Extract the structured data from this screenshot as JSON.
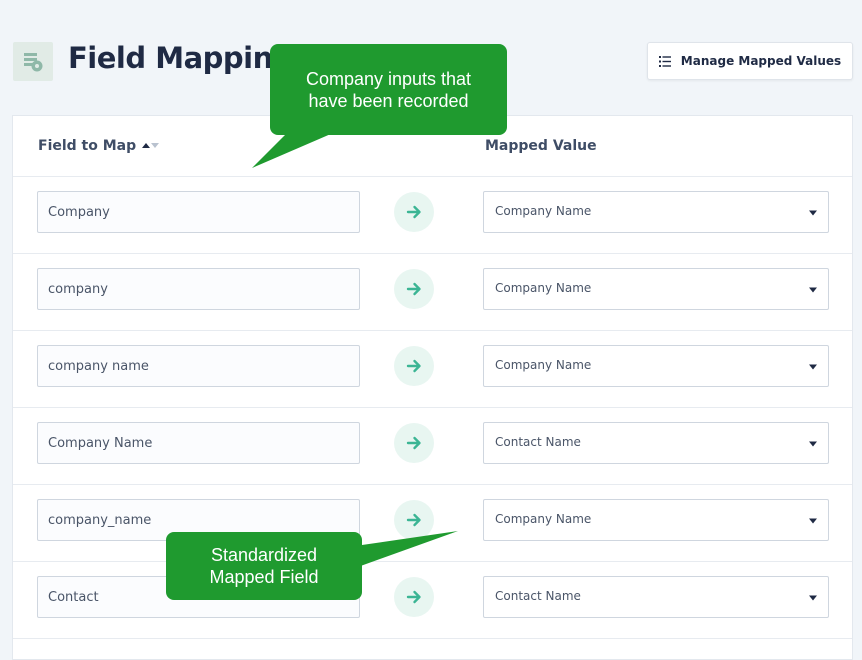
{
  "header": {
    "title": "Field Mapping",
    "icon": "database-settings-icon",
    "manage_button_label": "Manage Mapped Values",
    "manage_button_icon": "list-icon"
  },
  "table": {
    "columns": {
      "field": "Field to Map",
      "mapped": "Mapped Value"
    },
    "rows": [
      {
        "field": "Company",
        "mapped": "Company Name"
      },
      {
        "field": "company",
        "mapped": "Company Name"
      },
      {
        "field": "company name",
        "mapped": "Company Name"
      },
      {
        "field": "Company Name",
        "mapped": "Contact Name"
      },
      {
        "field": "company_name",
        "mapped": "Company Name"
      },
      {
        "field": "Contact",
        "mapped": "Contact Name"
      }
    ]
  },
  "callouts": {
    "top": "Company inputs that have been recorded",
    "bottom": "Standardized Mapped Field"
  },
  "colors": {
    "accent_arrow": "#3bb594",
    "callout_bg": "#1f9a2f",
    "title": "#1f2a44"
  }
}
